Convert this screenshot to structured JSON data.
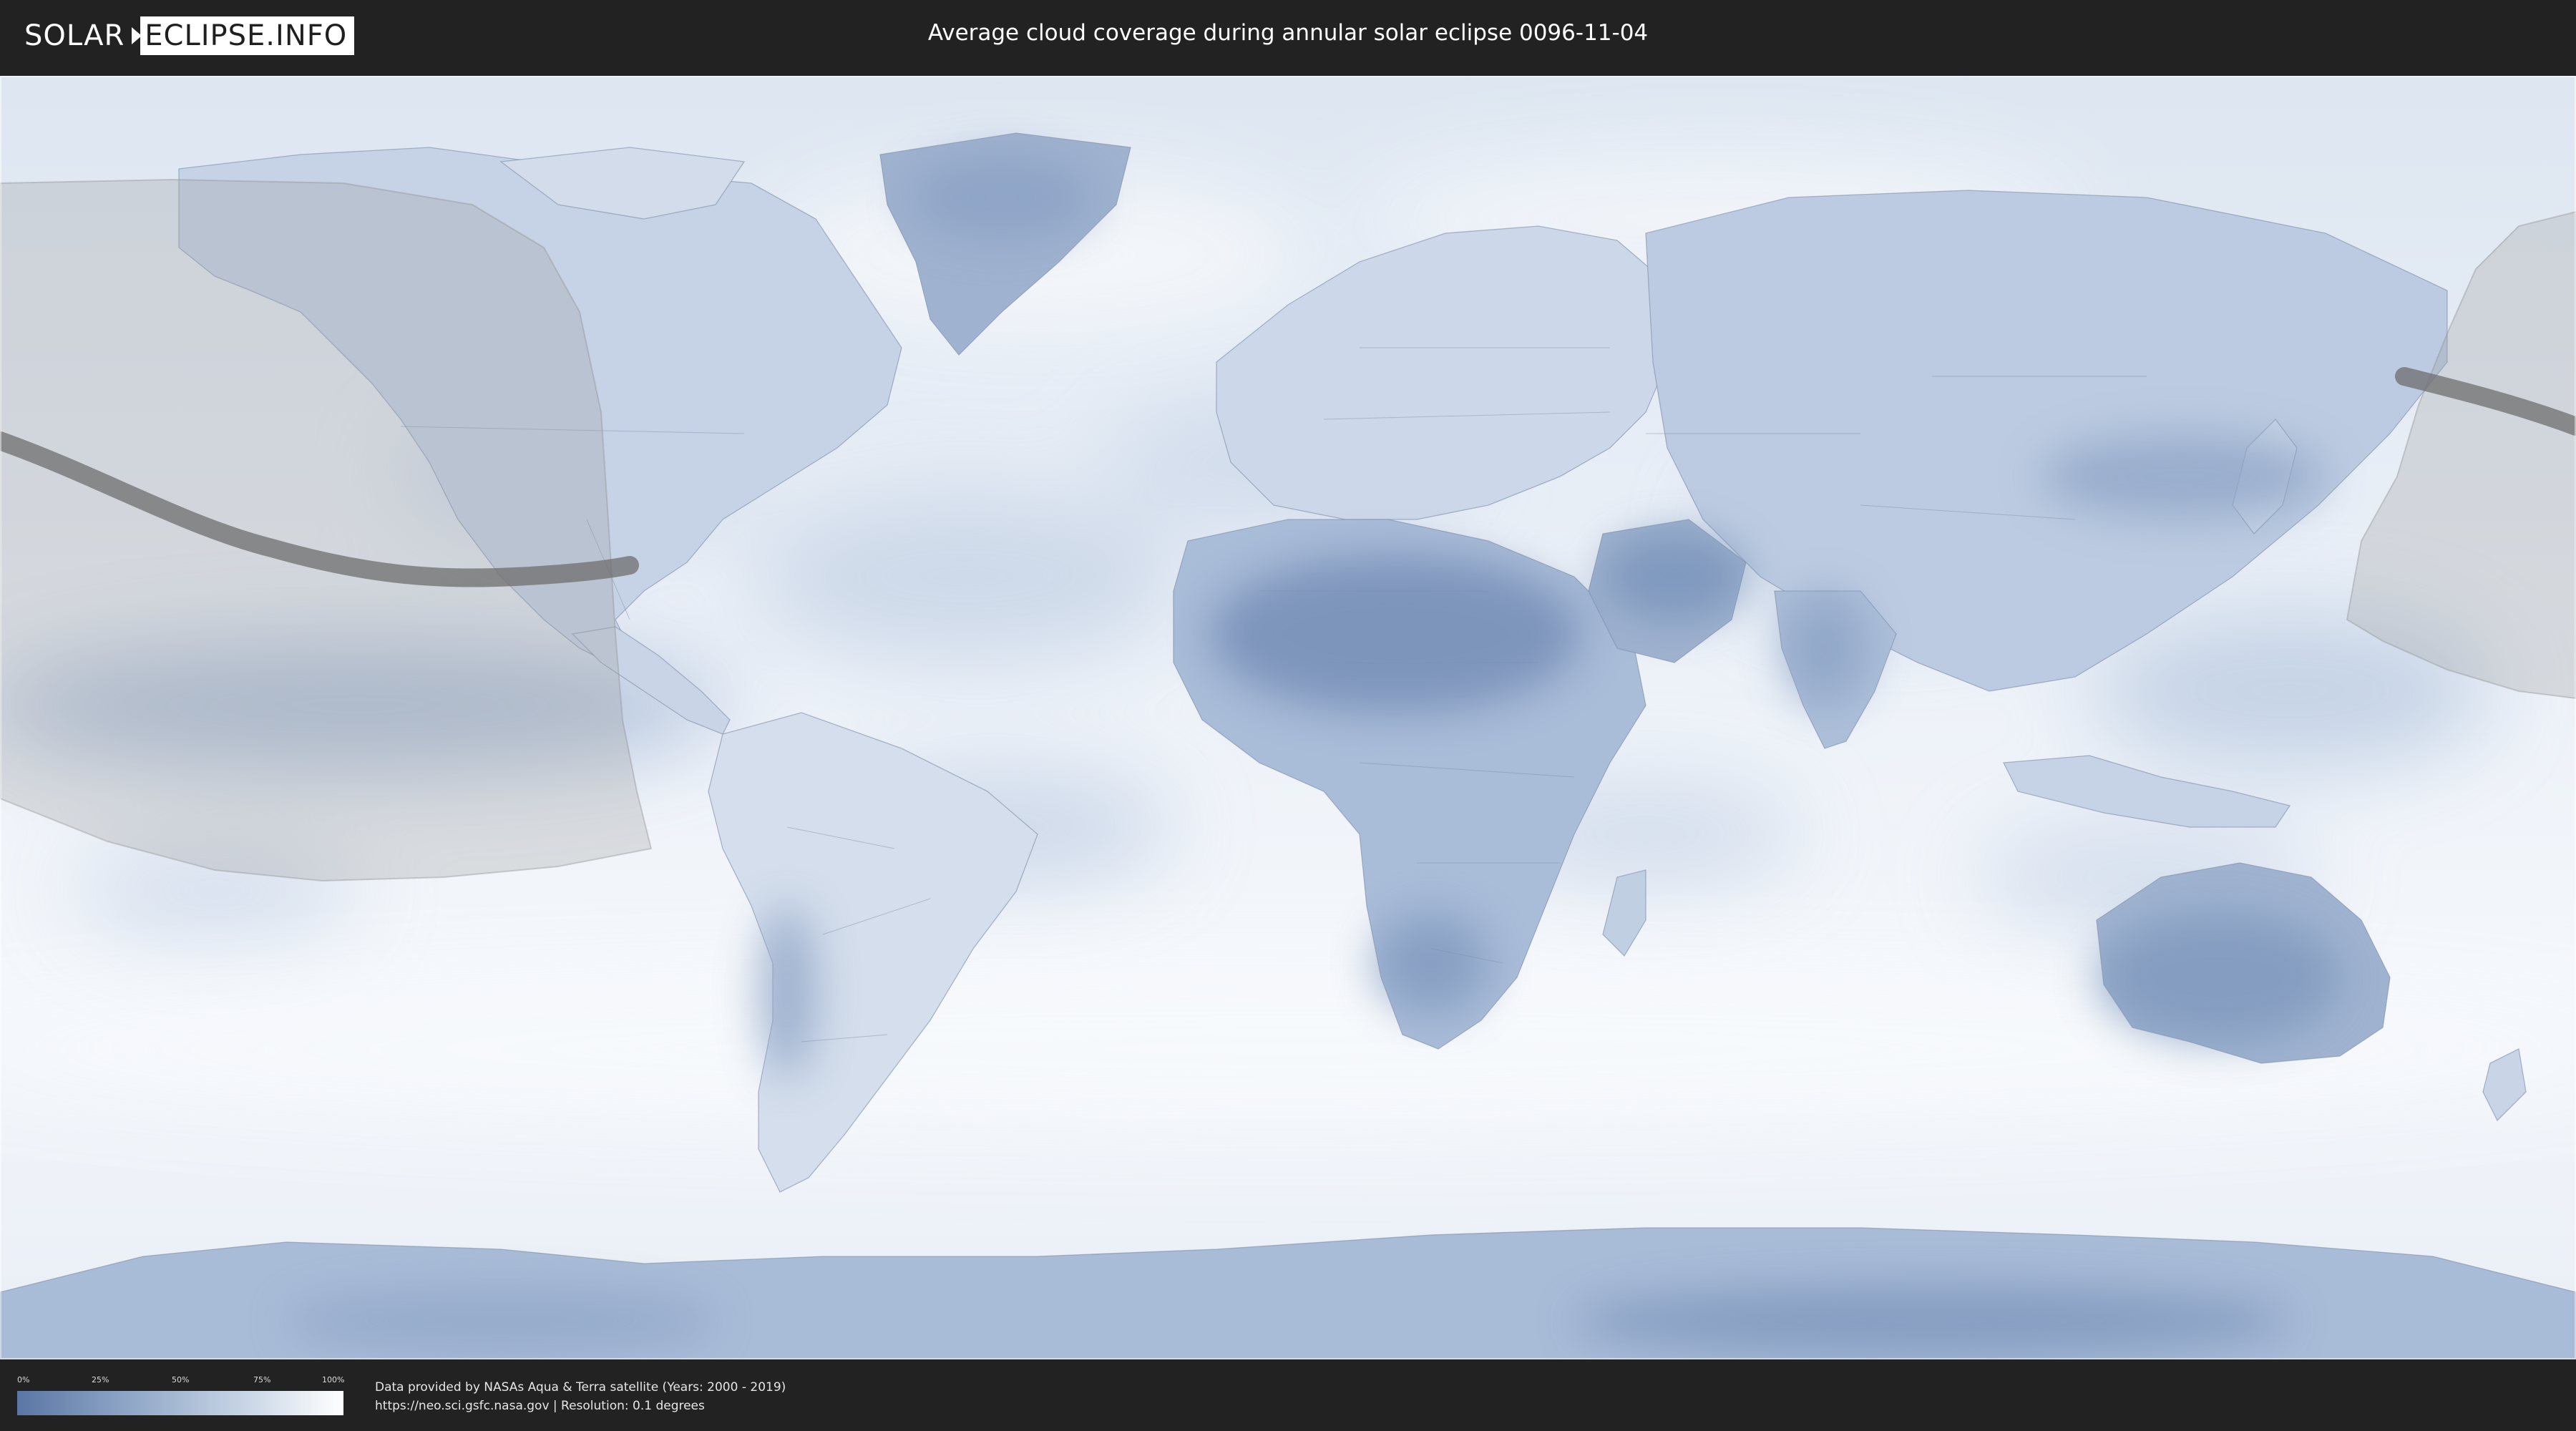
{
  "header": {
    "logo_solar": "SOLAR",
    "logo_eclipse": "ECLIPSE.INFO",
    "title": "Average cloud coverage during annular solar eclipse 0096-11-04"
  },
  "legend": {
    "ticks": [
      "0%",
      "25%",
      "50%",
      "75%",
      "100%"
    ],
    "colors": {
      "low": "#5a76a4",
      "mid": "#c3d1e3",
      "high": "#ffffff"
    }
  },
  "footer": {
    "credit_line1": "Data provided by NASAs Aqua & Terra satellite (Years: 2000 - 2019)",
    "credit_line2": "https://neo.sci.gsfc.nasa.gov | Resolution: 0.1 degrees"
  },
  "map": {
    "projection": "equirectangular",
    "eclipse_zone_color": "#9a9a9a",
    "central_line_color": "#6e6e6e",
    "cloud_color_clear": "#5a76a4",
    "cloud_color_cloudy": "#ffffff"
  }
}
